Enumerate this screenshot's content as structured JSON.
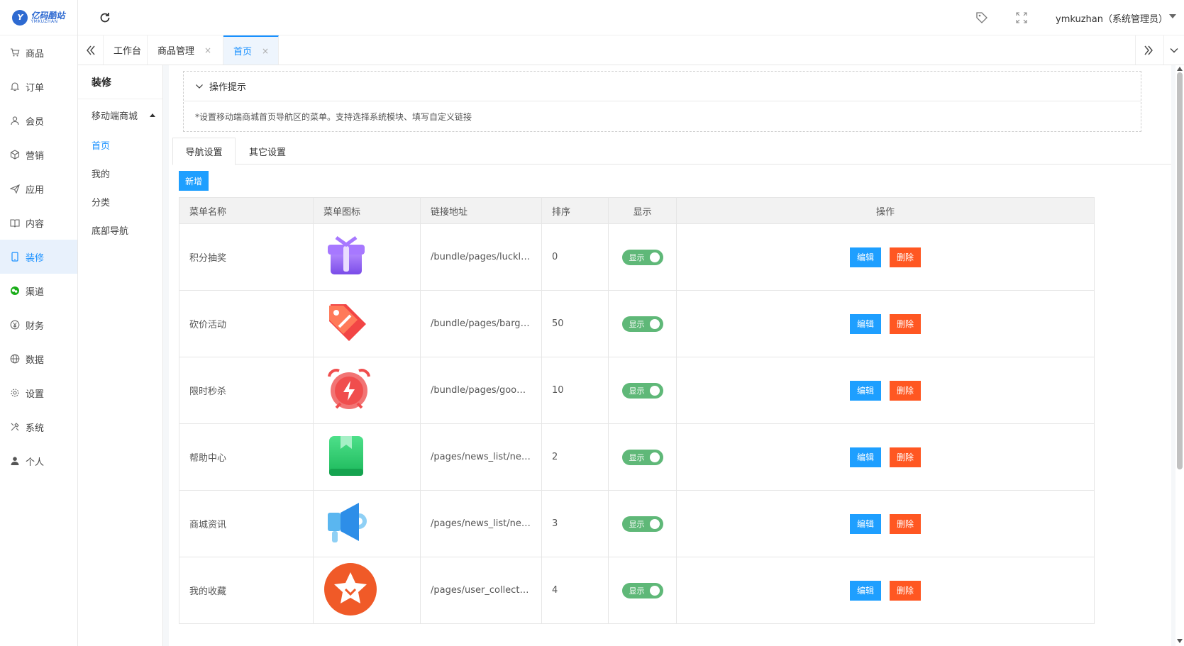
{
  "brand": {
    "logo_cn": "亿码酷站",
    "logo_en": "YMKUZHAN"
  },
  "sidebar": {
    "items": [
      {
        "label": "商品",
        "icon": "cart-icon"
      },
      {
        "label": "订单",
        "icon": "bell-icon"
      },
      {
        "label": "会员",
        "icon": "user-icon"
      },
      {
        "label": "营销",
        "icon": "box-icon"
      },
      {
        "label": "应用",
        "icon": "send-icon"
      },
      {
        "label": "内容",
        "icon": "book-icon"
      },
      {
        "label": "装修",
        "icon": "phone-icon"
      },
      {
        "label": "渠道",
        "icon": "wechat-icon"
      },
      {
        "label": "财务",
        "icon": "yen-icon"
      },
      {
        "label": "数据",
        "icon": "globe-icon"
      },
      {
        "label": "设置",
        "icon": "gear-icon"
      },
      {
        "label": "系统",
        "icon": "tools-icon"
      },
      {
        "label": "个人",
        "icon": "person-icon"
      }
    ],
    "active": "装修"
  },
  "header": {
    "user": "ymkuzhan（系统管理员）"
  },
  "tabs": [
    {
      "label": "工作台"
    },
    {
      "label": "商品管理",
      "close": "×"
    },
    {
      "label": "首页",
      "close": "×"
    }
  ],
  "subnav": {
    "title": "装修",
    "group": "移动端商城",
    "items": [
      "首页",
      "我的",
      "分类",
      "底部导航"
    ],
    "active": "首页"
  },
  "tip": {
    "title": "操作提示",
    "text": "*设置移动端商城首页导航区的菜单。支持选择系统模块、填写自定义链接"
  },
  "content_tabs": [
    "导航设置",
    "其它设置"
  ],
  "add_button": "新增",
  "table": {
    "headers": [
      "菜单名称",
      "菜单图标",
      "链接地址",
      "排序",
      "显示",
      "操作"
    ],
    "rows": [
      {
        "name": "积分抽奖",
        "icon": "gift-icon",
        "url": "/bundle/pages/luckly_...",
        "sort": "0",
        "show": "显示"
      },
      {
        "name": "砍价活动",
        "icon": "price-tag-icon",
        "url": "/bundle/pages/bargai...",
        "sort": "50",
        "show": "显示"
      },
      {
        "name": "限时秒杀",
        "icon": "alarm-clock-icon",
        "url": "/bundle/pages/goods...",
        "sort": "10",
        "show": "显示"
      },
      {
        "name": "帮助中心",
        "icon": "help-book-icon",
        "url": "/pages/news_list/new...",
        "sort": "2",
        "show": "显示"
      },
      {
        "name": "商城资讯",
        "icon": "megaphone-icon",
        "url": "/pages/news_list/new...",
        "sort": "3",
        "show": "显示"
      },
      {
        "name": "我的收藏",
        "icon": "star-badge-icon",
        "url": "/pages/user_collectio...",
        "sort": "4",
        "show": "显示"
      }
    ],
    "edit_label": "编辑",
    "delete_label": "删除"
  },
  "colors": {
    "primary": "#1e9fff",
    "danger": "#ff5722",
    "switch_on": "#5fb878",
    "active_nav_bg": "#e8f1fc"
  }
}
